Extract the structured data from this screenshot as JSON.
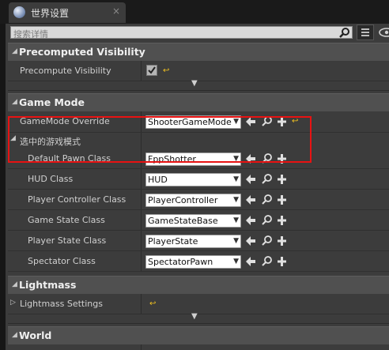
{
  "tab": {
    "title": "世界设置",
    "close": "×"
  },
  "search": {
    "placeholder": "搜索详情"
  },
  "sections": {
    "precomputed_visibility": {
      "label": "Precomputed Visibility",
      "row": {
        "label": "Precompute Visibility",
        "checked": true
      }
    },
    "game_mode": {
      "label": "Game Mode",
      "override": {
        "label": "GameMode Override",
        "value": "ShooterGameMode"
      },
      "selected_mode": {
        "label": "选中的游戏模式"
      },
      "rows": [
        {
          "label": "Default Pawn Class",
          "value": "FppShotter"
        },
        {
          "label": "HUD Class",
          "value": "HUD"
        },
        {
          "label": "Player Controller Class",
          "value": "PlayerController"
        },
        {
          "label": "Game State Class",
          "value": "GameStateBase"
        },
        {
          "label": "Player State Class",
          "value": "PlayerState"
        },
        {
          "label": "Spectator Class",
          "value": "SpectatorPawn"
        }
      ]
    },
    "lightmass": {
      "label": "Lightmass",
      "row": {
        "label": "Lightmass Settings"
      }
    },
    "world": {
      "label": "World"
    }
  },
  "colors": {
    "highlight": "#e81212",
    "reset_arrow": "#f0c020"
  },
  "icons": {
    "arrow_use": "use-selected-arrow-icon",
    "browse": "browse-magnifier-icon",
    "add": "add-plus-icon",
    "reset": "reset-to-default-icon"
  }
}
